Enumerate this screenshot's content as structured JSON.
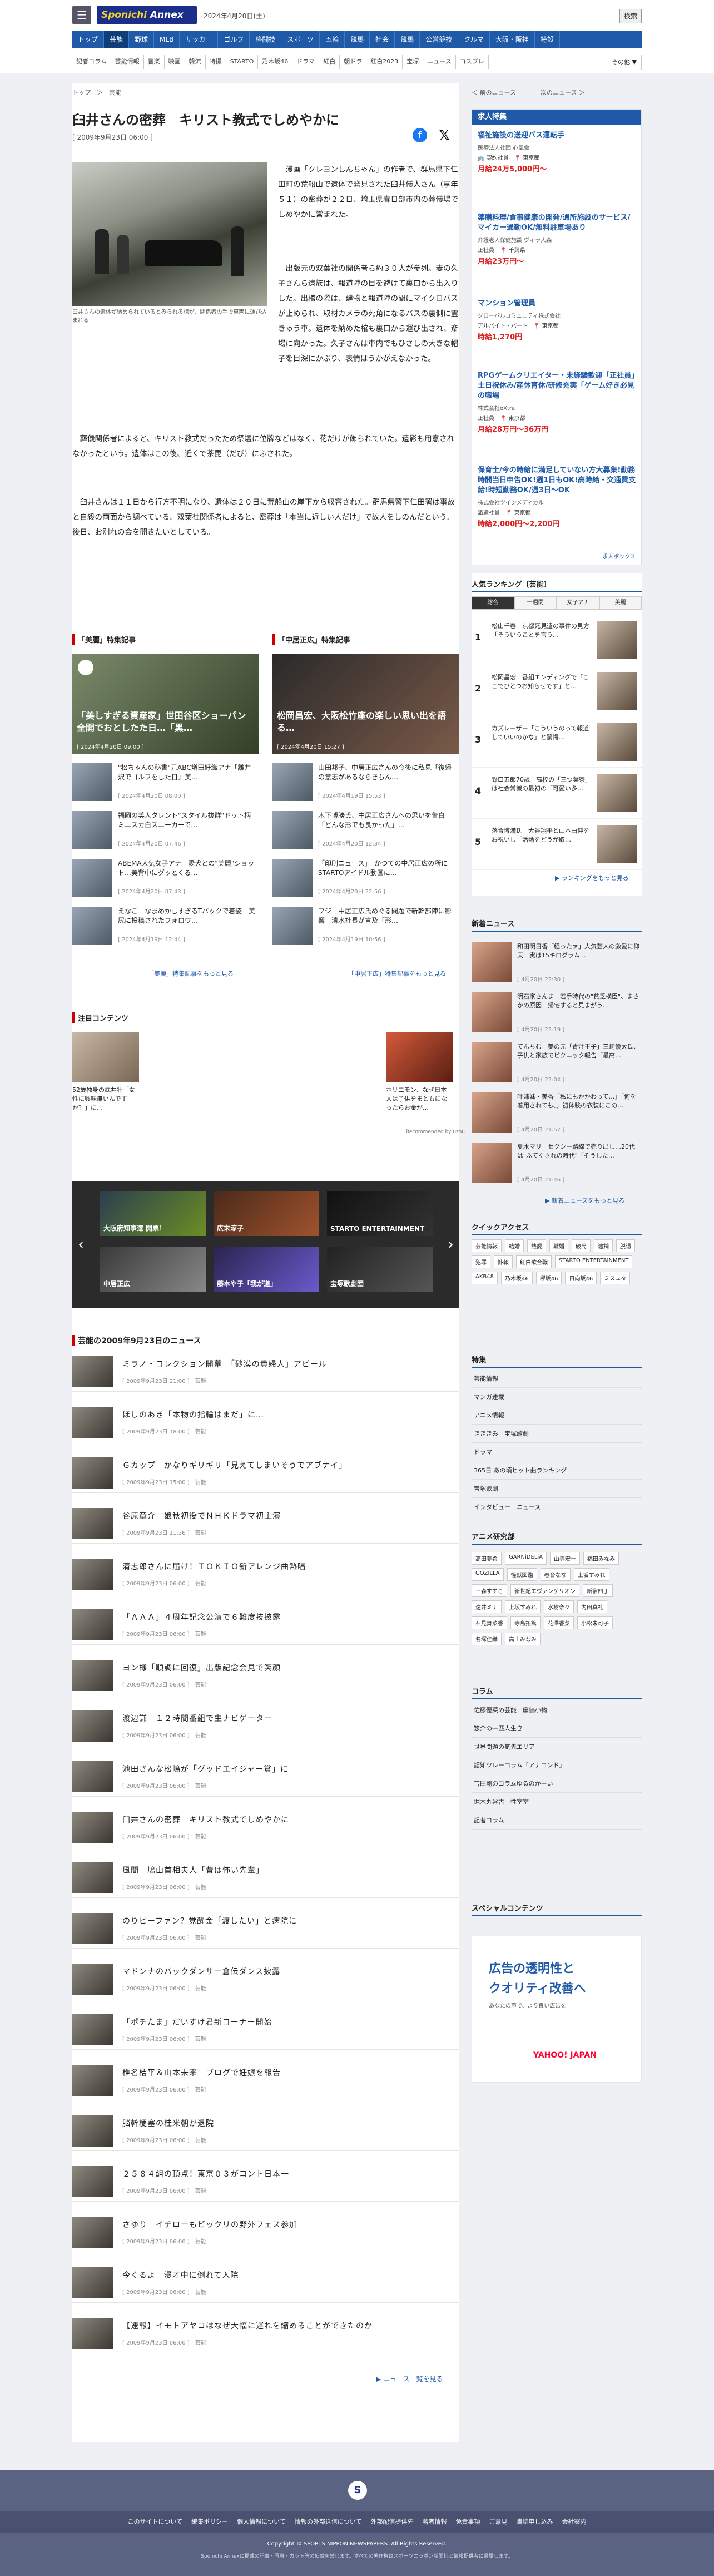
{
  "header": {
    "menu_label": "☰",
    "logo_main": "Sponichi",
    "logo_sub": " Annex",
    "date": "2024年4月20日(土)",
    "search_placeholder": "",
    "search_button": "検索",
    "gnav": [
      "トップ",
      "芸能",
      "野球",
      "MLB",
      "サッカー",
      "ゴルフ",
      "格闘技",
      "スポーツ",
      "五輪",
      "競馬",
      "社会",
      "競馬",
      "公営競技",
      "クルマ",
      "大阪・阪神",
      "特設"
    ],
    "snav": [
      "記者コラム",
      "芸能情報",
      "音楽",
      "映画",
      "韓流",
      "特撮",
      "STARTO",
      "乃木坂46",
      "ドラマ",
      "紅白",
      "朝ドラ",
      "紅白2023",
      "宝塚",
      "ニュース",
      "コスプレ"
    ],
    "snav_more": "その他 ▼"
  },
  "breadcrumb": "トップ　＞　芸能",
  "pager": "＜ 前のニュース　　　　次のニュース ＞",
  "article": {
    "title": "臼井さんの密葬　キリスト教式でしめやかに",
    "date": "[ 2009年9月23日 06:00 ]",
    "caption": "臼井さんの遺体が納められているとみられる棺が、関係者の手で車両に運び込まれる",
    "p1": "　漫画「クレヨンしんちゃん」の作者で、群馬県下仁田町の荒船山で遺体で発見された臼井儀人さん（享年５１）の密葬が２２日、埼玉県春日部市内の葬儀場でしめやかに営まれた。",
    "p2": "　出版元の双葉社の関係者ら約３０人が参列。妻の久子さんら遺族は、報道陣の目を避けて裏口から出入りした。出棺の際は、建物と報道陣の間にマイクロバスが止められ、取材カメラの死角になるバスの裏側に霊きゅう車。遺体を納めた棺も裏口から運び出され、斎場に向かった。久子さんは車内でもひさしの大きな帽子を目深にかぶり、表情はうかがえなかった。",
    "p3": "　葬儀関係者によると、キリスト教式だったため祭壇に位牌などはなく、花だけが飾られていた。遺影も用意されなかったという。遺体はこの後、近くで茶毘（だび）にふされた。",
    "p4": "　臼井さんは１１日から行方不明になり、遺体は２０日に荒船山の崖下から収容された。群馬県警下仁田署は事故と自殺の両面から調べている。双葉社関係者によると、密葬は「本当に近しい人だけ」で故人をしのんだという。後日、お別れの会を開きたいとしている。"
  },
  "special": {
    "left_heading": "「美麗」特集記事",
    "right_heading": "「中居正広」特集記事",
    "left_main_caption": "「美しすぎる資産家」世田谷区ショーパン全開でおとしたた日…「黒…",
    "left_main_date": "[ 2024年4月20日 09:00 ]",
    "right_main_caption": "松岡昌宏、大阪松竹座の楽しい思い出を語る…",
    "right_main_date": "[ 2024年4月20日 15:27 ]",
    "left_items": [
      {
        "t": "\"松ちゃんの秘書\"元ABC増田好織アナ「離井沢でゴルフをした日」美…",
        "d": "[ 2024年4月20日 08:00 ]"
      },
      {
        "t": "福岡の美人タレント\"スタイル抜群\"ドット柄ミニスカ白スニーカーで…",
        "d": "[ 2024年4月20日 07:46 ]"
      },
      {
        "t": "ABEMA人気女子アナ　愛犬との\"美麗\"ショット…美背中にグッとくる…",
        "d": "[ 2024年4月20日 07:43 ]"
      },
      {
        "t": "えなこ　なまめかしすぎるTバックで着姿　美尻に投稿されたフォロワ…",
        "d": "[ 2024年4月19日 12:44 ]"
      }
    ],
    "right_items": [
      {
        "t": "山田邦子、中居正広さんの今後に私見「復帰の意志があるならきちん…",
        "d": "[ 2024年4月19日 15:53 ]"
      },
      {
        "t": "木下博勝氏、中居正広さんへの思いを告白「どんな形でも良かった」…",
        "d": "[ 2024年4月20日 12:34 ]"
      },
      {
        "t": "「印刷ニュース」　かつての中居正広の所にSTARTOアイドル動画に…",
        "d": "[ 2024年4月20日 22:56 ]"
      },
      {
        "t": "フジ　中居正広氏めぐる問題で新幹部陣に影響　清水社長が言及「形…",
        "d": "[ 2024年4月19日 10:56 ]"
      }
    ],
    "left_more": "「美麗」特集記事をもっと見る",
    "right_more": "「中居正広」特集記事をもっと見る"
  },
  "notice": {
    "heading": "注目コンテンツ",
    "items": [
      {
        "t": "52歳独身の武井壮「女性に興味無いんですか？」に…"
      },
      {
        "t": "ホリエモン、なぜ日本人は子供をまともになったらお金が…"
      }
    ],
    "ad_label": "Recommended by uzou"
  },
  "carousel": {
    "tiles": [
      "大阪府知事選 開票！",
      "広末涼子",
      "STARTO ENTERTAINMENT",
      "中居正広",
      "藤本や子「我が道」",
      "宝塚歌劇団"
    ],
    "prev": "‹",
    "next": "›"
  },
  "news": {
    "heading": "芸能の2009年9月23日のニュース",
    "items": [
      {
        "t": "ミラノ・コレクション開幕　「砂漠の貴婦人」アピール",
        "d": "[ 2009年9月23日 21:00 ]　芸能"
      },
      {
        "t": "ほしのあき「本物の指輪はまだ」に…",
        "d": "[ 2009年9月23日 18:00 ]　芸能"
      },
      {
        "t": "Ｇカップ　かなりギリギリ「見えてしまいそうでアブナイ」",
        "d": "[ 2009年9月23日 15:00 ]　芸能"
      },
      {
        "t": "谷原章介　娘秋初役でＮＨＫドラマ初主演",
        "d": "[ 2009年9月23日 11:36 ]　芸能"
      },
      {
        "t": "清志郎さんに届け！ＴＯＫＩＯ新アレンジ曲熱唱",
        "d": "[ 2009年9月23日 06:00 ]　芸能"
      },
      {
        "t": "「ＡＡＡ」４周年記念公演で６難度技披露",
        "d": "[ 2009年9月23日 06:00 ]　芸能"
      },
      {
        "t": "ヨン様「順調に回復」出版記念会見で笑顔",
        "d": "[ 2009年9月23日 06:00 ]　芸能"
      },
      {
        "t": "渡辺謙　１２時間番組で生ナビゲーター",
        "d": "[ 2009年9月23日 06:00 ]　芸能"
      },
      {
        "t": "池田さんな松嶋が「グッドエイジャー賞」に",
        "d": "[ 2009年9月23日 06:00 ]　芸能"
      },
      {
        "t": "臼井さんの密葬　キリスト教式でしめやかに",
        "d": "[ 2009年9月23日 06:00 ]　芸能"
      },
      {
        "t": "風間　鳩山首相夫人「昔は怖い先輩」",
        "d": "[ 2009年9月23日 06:00 ]　芸能"
      },
      {
        "t": "のりピーファン？覚醒金「渡したい」と病院に",
        "d": "[ 2009年9月23日 06:00 ]　芸能"
      },
      {
        "t": "マドンナのバックダンサー倉伝ダンス披露",
        "d": "[ 2009年9月23日 06:00 ]　芸能"
      },
      {
        "t": "「ポチたま」だいすけ君新コーナー開始",
        "d": "[ 2009年9月23日 06:00 ]　芸能"
      },
      {
        "t": "椎名桔平＆山本未来　ブログで妊娠を報告",
        "d": "[ 2009年9月23日 06:00 ]　芸能"
      },
      {
        "t": "脳幹梗塞の桂米朝が退院",
        "d": "[ 2009年9月23日 06:00 ]　芸能"
      },
      {
        "t": "２５８４組の頂点！東京０３がコント日本一",
        "d": "[ 2009年9月23日 06:00 ]　芸能"
      },
      {
        "t": "さゆり　イチローもビックリの野外フェス参加",
        "d": "[ 2009年9月23日 06:00 ]　芸能"
      },
      {
        "t": "今くるよ　漫才中に倒れて入院",
        "d": "[ 2009年9月23日 06:00 ]　芸能"
      },
      {
        "t": "【速報】イモトアヤコはなぜ大幅に遅れを縮めることができたのか",
        "d": "[ 2009年9月23日 06:00 ]　芸能"
      }
    ],
    "more": "▶ ニュース一覧を見る"
  },
  "jobs": {
    "heading": "求人特集",
    "items": [
      {
        "title": "福祉施設の送迎バス運転手",
        "co": "医療法人社団 心風会",
        "meta": "🚌 契約社員　📍 東京都",
        "pay": "月給24万5,000円〜"
      },
      {
        "title": "薬膳料理/食事健康の開発/通所施設のサービス/マイカー通勤OK/無料駐車場あり",
        "co": "介護老人保健施設 ヴィラ大森",
        "meta": "正社員　📍 千葉県",
        "pay": "月給23万円〜"
      },
      {
        "title": "マンション管理員",
        "co": "グローバルコミュニティ株式会社",
        "meta": "アルバイト・パート　📍 東京都",
        "pay": "時給1,270円"
      },
      {
        "title": "RPGゲームクリエイター・未経験歓迎「正社員」土日祝休み/産休育休/研修充実「ゲーム好き必見の職場",
        "co": "株式会社eXtra",
        "meta": "正社員　📍 東京都",
        "pay": "月給28万円〜36万円"
      },
      {
        "title": "保育士/今の時給に満足していない方大募集!勤務時間当日申告OK!週1日もOK!高時給・交通費支給!時短勤務OK/週3日〜OK",
        "co": "株式会社ツインメディカル",
        "meta": "派遣社員　📍 東京都",
        "pay": "時給2,000円〜2,200円"
      }
    ],
    "footer": "求人ボックス"
  },
  "ranking": {
    "heading": "人気ランキング〔芸能〕",
    "tabs": [
      "総合",
      "一週間",
      "女子アナ",
      "美麗"
    ],
    "items": [
      {
        "n": "1",
        "t": "松山千春　京都死見遣の事件の見方「そういうことを言う…"
      },
      {
        "n": "2",
        "t": "松岡昌宏　番組エンディングで「ここでひとつお知らせです」と…"
      },
      {
        "n": "3",
        "t": "カズレーザー「こういうのって報道していいのかな」と驚愕…"
      },
      {
        "n": "4",
        "t": "野口五郎70歳　高校の「三つ葉寮」は社会常識の最初の「可愛い多…"
      },
      {
        "n": "5",
        "t": "落合博満氏　大谷翔平と山本由伸をお祝いし「活動をどうが取…"
      }
    ],
    "more": "▶ ランキングをもっと見る"
  },
  "new_news": {
    "heading": "新着ニュース",
    "items": [
      {
        "t": "和田明日香「経ったァ」人気芸人の激愛に仰天　実は15キログラム…",
        "d": "[ 4月20日 22:30 ]"
      },
      {
        "t": "明石家さんま　若手時代の\"貧乏横臣\"、まさかの原因　帰宅すると見まがう…",
        "d": "[ 4月20日 22:19 ]"
      },
      {
        "t": "てんちむ　美の元「青汁王子」三崎優太氏、子供と家族でピクニック報告「最高…",
        "d": "[ 4月20日 22:04 ]"
      },
      {
        "t": "叶姉妹・美香「私にもかかわって…」「何を着用されても、」初体験の衣装にこの…",
        "d": "[ 4月20日 21:57 ]"
      },
      {
        "t": "夏木マリ　セクシー路線で売り出し…20代は\"ふてくされの時代\"「そうした…",
        "d": "[ 4月20日 21:46 ]"
      }
    ],
    "more": "▶ 新着ニュースをもっと見る"
  },
  "quick_access": {
    "heading": "クイックアクセス",
    "tags": [
      "芸能情報",
      "結婚",
      "熱愛",
      "離婚",
      "破局",
      "逮捕",
      "脱退",
      "犯罪",
      "訃報",
      "紅白歌合戦",
      "STARTO ENTERTAINMENT",
      "AKB48",
      "乃木坂46",
      "欅坂46",
      "日向坂46",
      "ミスユタ"
    ]
  },
  "feature": {
    "heading": "特集",
    "items": [
      "芸能情報",
      "マンガ連載",
      "アニメ情報",
      "きききみ　宝塚歌劇",
      "ドラマ",
      "365日 あの頃ヒット曲ランキング",
      "宝塚歌劇",
      "インタビュー　ニュース"
    ]
  },
  "anime": {
    "heading": "アニメ研究部",
    "tags": [
      "高田夢希",
      "GARNiDELiA",
      "山寺宏一",
      "福田みなみ",
      "GOZILLA",
      "怪獣図鑑",
      "春台なな",
      "上坂すみれ",
      "三森すずこ",
      "新世紀エヴァンゲリオン",
      "新宿四丁",
      "遠井ミナ",
      "上坂すみれ",
      "水樹奈々",
      "内田真礼",
      "石見舞菜香",
      "寺島拓篤",
      "花澤香菜",
      "小松未可子",
      "名塚佳織",
      "高山みなみ"
    ]
  },
  "column": {
    "heading": "コラム",
    "items": [
      "佐藤優菜の芸能　廉価小物",
      "惣介の一匹人生き",
      "世界問題の気先エリア",
      "認知ツレーコラム「アナコンド」",
      "吉田剛のコラムゆるのかーい",
      "堀木丸谷古　性室室",
      "記者コラム"
    ]
  },
  "special_contents": {
    "heading": "スペシャルコンテンツ",
    "ad_line1": "広告の透明性と",
    "ad_line2": "クオリティ改善へ",
    "ad_sub": "あなたの声で、より良い広告を",
    "ad_brand": "YAHOO! JAPAN"
  },
  "footer": {
    "logo": "S",
    "nav": [
      "このサイトについて",
      "編集ポリシー",
      "個人情報について",
      "情報の外部送信について",
      "外部配信提供先",
      "著者情報",
      "免責事項",
      "ご意見",
      "購読申し込み",
      "会社案内"
    ],
    "copyright": "Copyright © SPORTS NIPPON NEWSPAPERS. All Rights Reserved.",
    "note": "Sponichi Annexに掲載の記事・写真・カット等の転載を禁じます。すべての著作権はスポーツニッポン新聞社と情報提供者に帰属します。"
  },
  "colors": {
    "accent": "#1e5aa8",
    "logo": "#1b2f8a",
    "red": "#d22",
    "footer": "#5b6382"
  }
}
